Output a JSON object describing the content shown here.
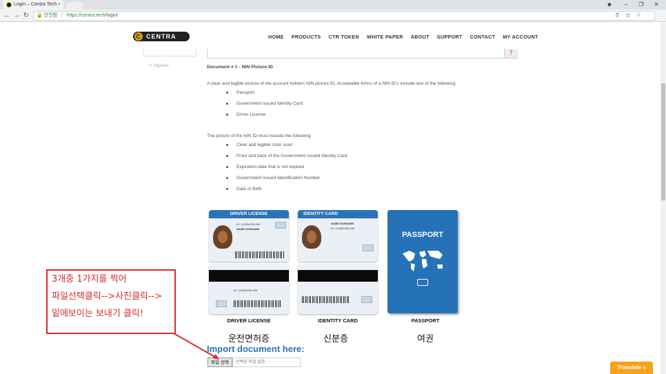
{
  "browser": {
    "tab_title": "Login – Centra Tech",
    "tab_close": "×",
    "win_min": "–",
    "win_restore": "❐",
    "win_close": "✕",
    "win_user": "☻",
    "secure_label": "안전함",
    "url_scheme_host": "https://centra.tech",
    "url_path": "/login/",
    "omni_icons": "⚿ ⇄ ☆ ⋮"
  },
  "site": {
    "logo_text": "CENTRA",
    "menu": [
      "HOME",
      "PRODUCTS",
      "CTR TOKEN",
      "WHITE PAPER",
      "ABOUT",
      "SUPPORT",
      "CONTACT",
      "MY ACCOUNT"
    ]
  },
  "sidebar": {
    "signout": "↪ Signout"
  },
  "main": {
    "help_icon": "❓",
    "doc_title": "Document # 1 - NIN Picture ID",
    "intro": "A clear and legible picture of the account holders NIN picture ID. Acceptable forms of a NIN ID's include one of the following:",
    "forms": [
      "Passport",
      "Government issued Identity Card",
      "Driver License"
    ],
    "must_include_intro": "The picture of the NIN ID must include the following:",
    "requirements": [
      "Clear and legible color scan",
      "Front and back of the Government issued Identity Card",
      "Expiration date that is not expired",
      "Government issued Identification Number",
      "Date of Birth"
    ]
  },
  "cards": {
    "driver_head": "DRIVER LICENSE",
    "identity_head": "IDENTITY CARD",
    "passport_title": "PASSPORT",
    "id_no": "ID: 123456789-005",
    "name": "NAME SURNAME",
    "caption_driver": "DRIVER LICENSE",
    "caption_identity": "IDENTITY CARD",
    "caption_passport": "PASSPORT",
    "kor_driver": "운전면허증",
    "kor_identity": "신분증",
    "kor_passport": "여권"
  },
  "upload": {
    "title": "Import document here:",
    "button": "파일 선택",
    "no_file": "선택된 파일 없음"
  },
  "annotation": {
    "lines": [
      "3개중 1가지를 찍어",
      "파일선택클릭-->사진클릭-->",
      "밑에보이는 보내기 클릭!"
    ],
    "color": "#d72b2b"
  },
  "translate": "Translate »"
}
